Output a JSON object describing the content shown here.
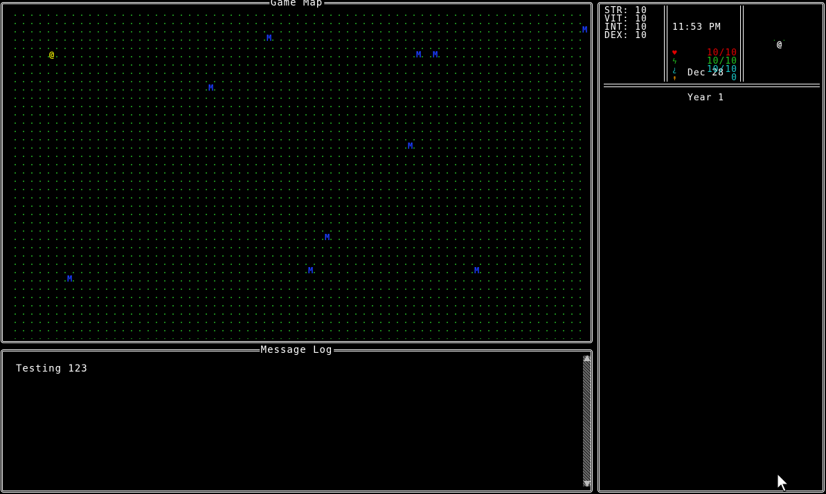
{
  "map": {
    "title": "Game Map"
  },
  "player": {
    "glyph": "@",
    "color": "#e8e800"
  },
  "monsters": {
    "glyph": "M",
    "color": "#1a3cff"
  },
  "log": {
    "title": "Message Log",
    "messages": [
      "Testing 123"
    ]
  },
  "stats": {
    "str": "STR: 10",
    "vit": "VIT: 10",
    "int": "INT: 10",
    "dex": "DEX: 10"
  },
  "clock": {
    "time": "11:53 PM",
    "date": "Dec 28",
    "year": "Year 1"
  },
  "bars": {
    "health": {
      "value": "10/10",
      "color": "#e00000",
      "icon": "heart-icon"
    },
    "energy": {
      "value": "10/10",
      "color": "#22c422",
      "icon": "lightning-icon"
    },
    "mana": {
      "value": "10/10",
      "color": "#19c8c8",
      "icon": "water-icon"
    },
    "xp": {
      "value": "0",
      "color": "#19c8c8",
      "icon": "level-up-icon"
    }
  },
  "minimap": {
    "player": "@"
  }
}
